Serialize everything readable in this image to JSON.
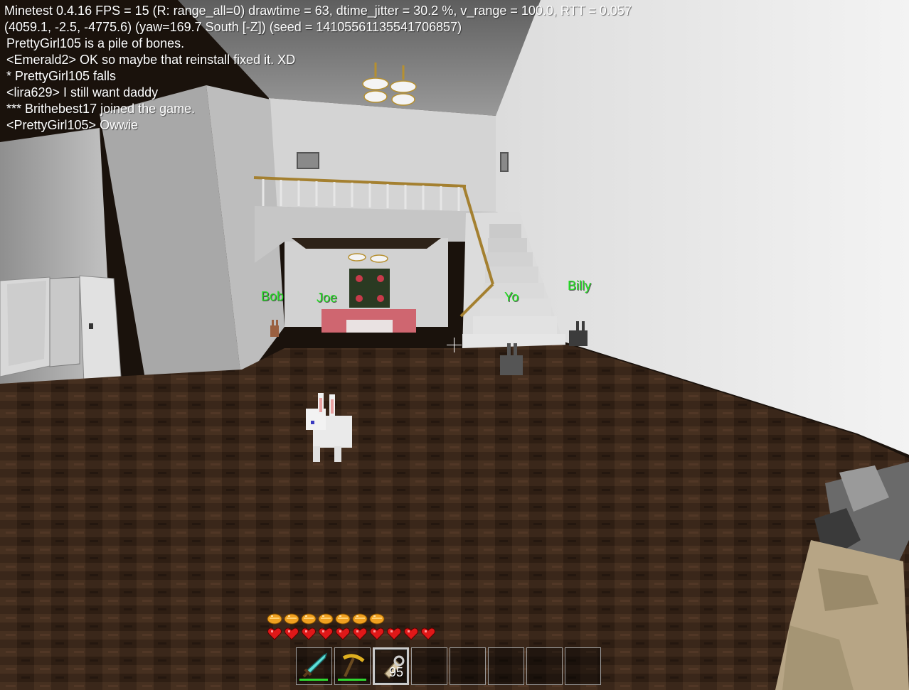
{
  "debug": {
    "line1": "Minetest 0.4.16 FPS = 15 (R: range_all=0) drawtime = 63, dtime_jitter = 30.2 %, v_range = 100.0, RTT = 0.057",
    "line2": "(4059.1, -2.5, -4775.6) (yaw=169.7 South [-Z]) (seed = 14105561135541706857)"
  },
  "chat": [
    "PrettyGirl105 is a pile of bones.",
    "<Emerald2> OK so maybe that reinstall fixed it. XD",
    "* PrettyGirl105 falls",
    "<lira629> I still want daddy",
    "*** Brithebest17 joined the game.",
    "<PrettyGirl105> Owwie"
  ],
  "nametags": {
    "bob": "Bob",
    "joe": "Joe",
    "yo": "Yo",
    "billy": "Billy"
  },
  "nametag_color": "#23e023",
  "hud": {
    "hunger": {
      "current": 7,
      "icon": "bread-icon",
      "color": "#f0a020"
    },
    "health": {
      "current": 10,
      "icon": "heart-icon",
      "color": "#e01818"
    },
    "hotbar": {
      "selected_index": 2,
      "slots": [
        {
          "item": "diamond-sword-icon",
          "wear": 1.0
        },
        {
          "item": "gold-pickaxe-icon",
          "wear": 1.0
        },
        {
          "item": "flint-and-steel-icon",
          "count": "95"
        },
        {
          "item": ""
        },
        {
          "item": ""
        },
        {
          "item": ""
        },
        {
          "item": ""
        },
        {
          "item": ""
        }
      ]
    }
  }
}
